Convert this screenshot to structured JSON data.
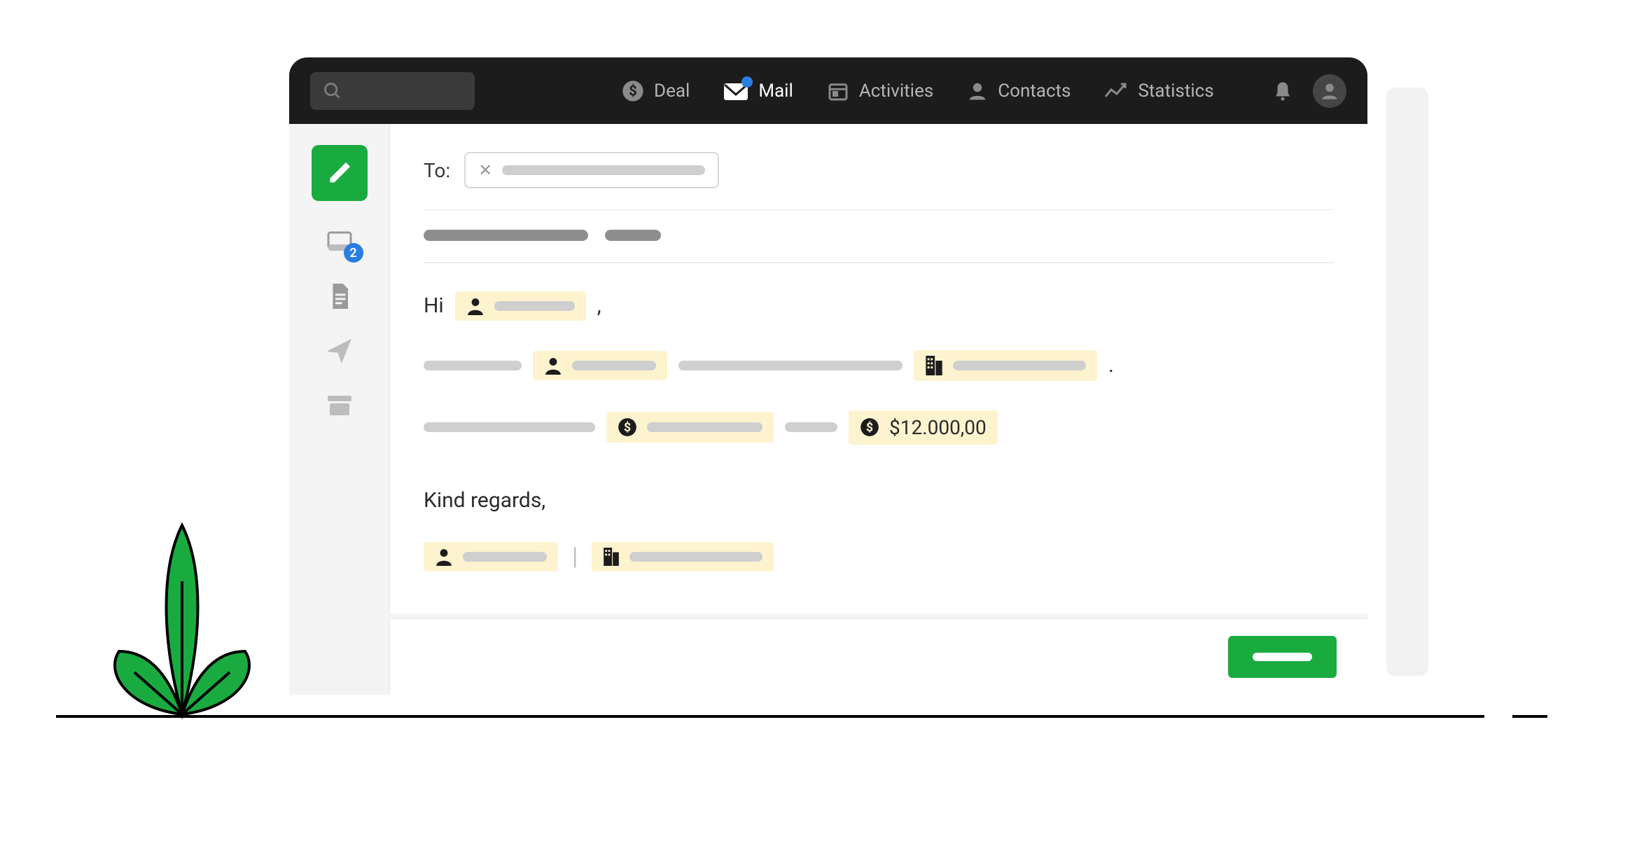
{
  "nav": {
    "items": [
      {
        "label": "Deal",
        "icon": "dollar-circle-icon"
      },
      {
        "label": "Mail",
        "icon": "mail-icon",
        "active": true,
        "badge": true
      },
      {
        "label": "Activities",
        "icon": "calendar-icon"
      },
      {
        "label": "Contacts",
        "icon": "person-icon"
      },
      {
        "label": "Statistics",
        "icon": "chart-line-icon"
      }
    ]
  },
  "sidebar": {
    "inbox_badge": "2"
  },
  "compose": {
    "to_label": "To:",
    "greeting": "Hi",
    "greeting_comma": ",",
    "period": ".",
    "deal_value": "$12.000,00",
    "signoff": "Kind regards,"
  }
}
